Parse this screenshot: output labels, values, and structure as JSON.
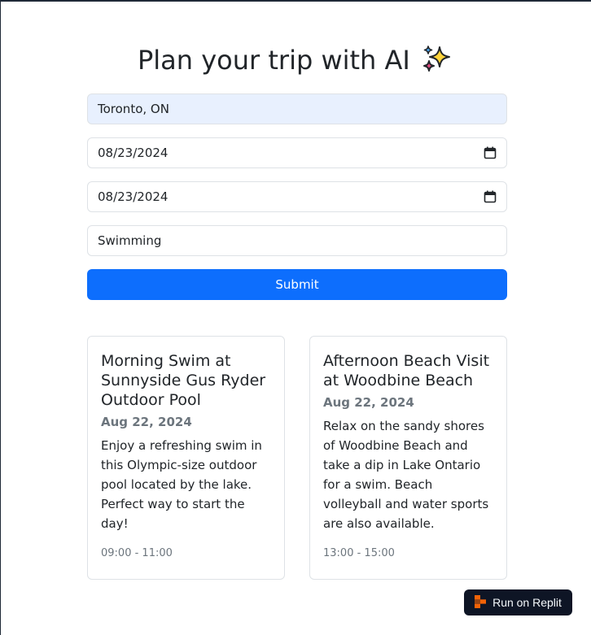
{
  "page": {
    "title": "Plan your trip with AI",
    "title_icon": "sparkles-icon"
  },
  "form": {
    "location": {
      "value": "Toronto, ON"
    },
    "start_date": {
      "value": "08/23/2024",
      "icon": "calendar-icon"
    },
    "end_date": {
      "value": "08/23/2024",
      "icon": "calendar-icon"
    },
    "activity": {
      "value": "Swimming"
    },
    "submit_label": "Submit"
  },
  "results": [
    {
      "title": "Morning Swim at Sunnyside Gus Ryder Outdoor Pool",
      "date": "Aug 22, 2024",
      "description": "Enjoy a refreshing swim in this Olympic-size outdoor pool located by the lake. Perfect way to start the day!",
      "time": "09:00 - 11:00"
    },
    {
      "title": "Afternoon Beach Visit at Woodbine Beach",
      "date": "Aug 22, 2024",
      "description": "Relax on the sandy shores of Woodbine Beach and take a dip in Lake Ontario for a swim. Beach volleyball and water sports are also available.",
      "time": "13:00 - 15:00"
    }
  ],
  "replit_badge": {
    "label": "Run on Replit",
    "icon": "replit-logo-icon"
  },
  "colors": {
    "primary": "#0d6efd",
    "autofill_bg": "#e8f0fe",
    "muted_text": "#6c757d",
    "badge_bg": "#0e1525",
    "replit_orange": "#f26207"
  }
}
